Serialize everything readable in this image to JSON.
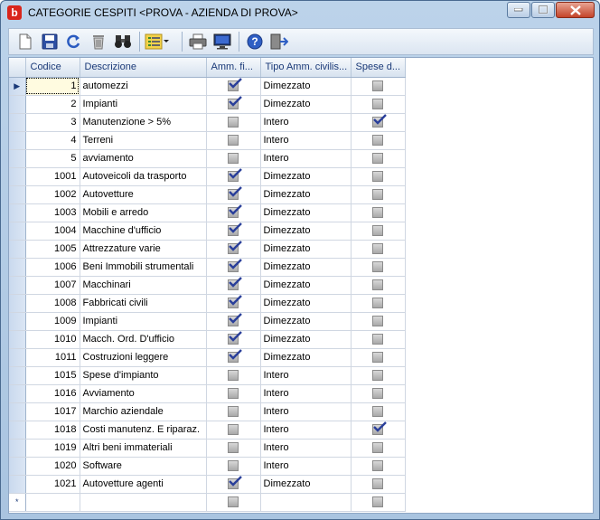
{
  "window": {
    "app_icon_letter": "b",
    "title": "CATEGORIE CESPITI <PROVA - AZIENDA DI PROVA>"
  },
  "toolbar": {
    "buttons": [
      "new-document-icon",
      "save-icon",
      "refresh-icon",
      "delete-icon",
      "binoculars-icon",
      "list-options-icon",
      "print-icon",
      "monitor-icon",
      "help-icon",
      "exit-icon"
    ]
  },
  "grid": {
    "columns": [
      "Codice",
      "Descrizione",
      "Amm. fi...",
      "Tipo Amm. civilis...",
      "Spese d..."
    ],
    "new_row_marker": "*",
    "current_row_marker": "▶",
    "rows": [
      {
        "codice": "1",
        "descrizione": "automezzi",
        "amm_fiscale": true,
        "tipo": "Dimezzato",
        "spese": false
      },
      {
        "codice": "2",
        "descrizione": "Impianti",
        "amm_fiscale": true,
        "tipo": "Dimezzato",
        "spese": false
      },
      {
        "codice": "3",
        "descrizione": "Manutenzione > 5%",
        "amm_fiscale": false,
        "tipo": "Intero",
        "spese": true
      },
      {
        "codice": "4",
        "descrizione": "Terreni",
        "amm_fiscale": false,
        "tipo": "Intero",
        "spese": false
      },
      {
        "codice": "5",
        "descrizione": "avviamento",
        "amm_fiscale": false,
        "tipo": "Intero",
        "spese": false
      },
      {
        "codice": "1001",
        "descrizione": "Autoveicoli da trasporto",
        "amm_fiscale": true,
        "tipo": "Dimezzato",
        "spese": false
      },
      {
        "codice": "1002",
        "descrizione": "Autovetture",
        "amm_fiscale": true,
        "tipo": "Dimezzato",
        "spese": false
      },
      {
        "codice": "1003",
        "descrizione": "Mobili e arredo",
        "amm_fiscale": true,
        "tipo": "Dimezzato",
        "spese": false
      },
      {
        "codice": "1004",
        "descrizione": "Macchine d'ufficio",
        "amm_fiscale": true,
        "tipo": "Dimezzato",
        "spese": false
      },
      {
        "codice": "1005",
        "descrizione": "Attrezzature varie",
        "amm_fiscale": true,
        "tipo": "Dimezzato",
        "spese": false
      },
      {
        "codice": "1006",
        "descrizione": "Beni Immobili strumentali",
        "amm_fiscale": true,
        "tipo": "Dimezzato",
        "spese": false
      },
      {
        "codice": "1007",
        "descrizione": "Macchinari",
        "amm_fiscale": true,
        "tipo": "Dimezzato",
        "spese": false
      },
      {
        "codice": "1008",
        "descrizione": "Fabbricati civili",
        "amm_fiscale": true,
        "tipo": "Dimezzato",
        "spese": false
      },
      {
        "codice": "1009",
        "descrizione": "Impianti",
        "amm_fiscale": true,
        "tipo": "Dimezzato",
        "spese": false
      },
      {
        "codice": "1010",
        "descrizione": "Macch. Ord. D'ufficio",
        "amm_fiscale": true,
        "tipo": "Dimezzato",
        "spese": false
      },
      {
        "codice": "1011",
        "descrizione": "Costruzioni leggere",
        "amm_fiscale": true,
        "tipo": "Dimezzato",
        "spese": false
      },
      {
        "codice": "1015",
        "descrizione": "Spese d'impianto",
        "amm_fiscale": false,
        "tipo": "Intero",
        "spese": false
      },
      {
        "codice": "1016",
        "descrizione": "Avviamento",
        "amm_fiscale": false,
        "tipo": "Intero",
        "spese": false
      },
      {
        "codice": "1017",
        "descrizione": "Marchio aziendale",
        "amm_fiscale": false,
        "tipo": "Intero",
        "spese": false
      },
      {
        "codice": "1018",
        "descrizione": "Costi manutenz. E riparaz.",
        "amm_fiscale": false,
        "tipo": "Intero",
        "spese": true
      },
      {
        "codice": "1019",
        "descrizione": "Altri beni immateriali",
        "amm_fiscale": false,
        "tipo": "Intero",
        "spese": false
      },
      {
        "codice": "1020",
        "descrizione": "Software",
        "amm_fiscale": false,
        "tipo": "Intero",
        "spese": false
      },
      {
        "codice": "1021",
        "descrizione": "Autovetture agenti",
        "amm_fiscale": true,
        "tipo": "Dimezzato",
        "spese": false
      }
    ]
  }
}
